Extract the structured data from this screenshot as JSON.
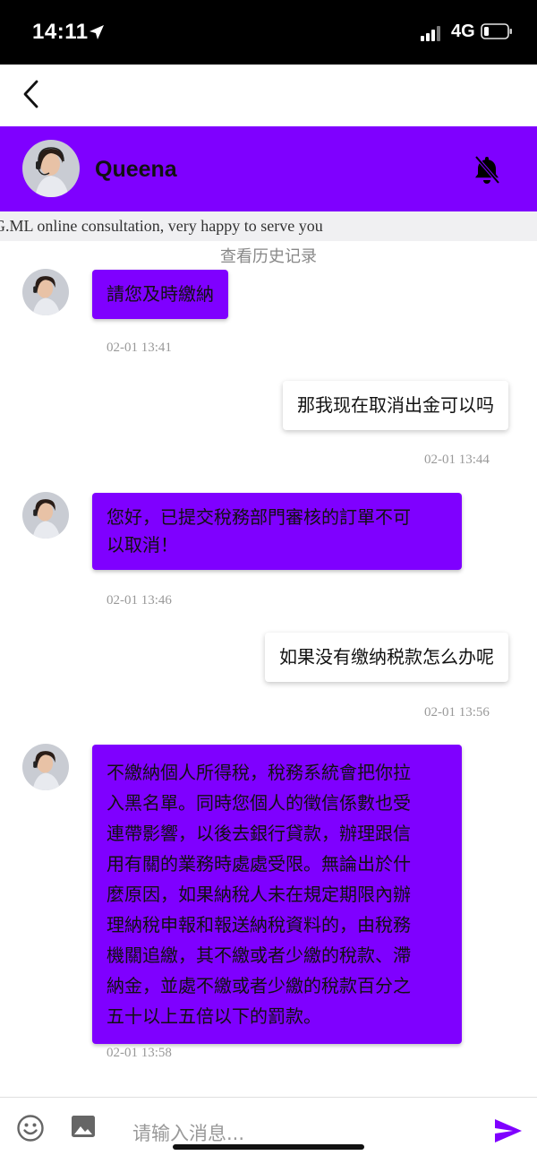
{
  "status_bar": {
    "time": "14:11",
    "network": "4G"
  },
  "header": {
    "name": "Queena",
    "welcome": "G.ML online consultation, very happy to serve you"
  },
  "history_link": "查看历史记录",
  "messages": [
    {
      "direction": "incoming",
      "text": "請您及時繳納",
      "time": "02-01 13:41"
    },
    {
      "direction": "outgoing",
      "text": "那我现在取消出金可以吗",
      "time": "02-01 13:44"
    },
    {
      "direction": "incoming",
      "lines": [
        "您好，已提交稅務部門審核的訂單不可",
        "以取消！"
      ],
      "time": "02-01 13:46"
    },
    {
      "direction": "outgoing",
      "text": "如果没有缴纳税款怎么办呢",
      "time": "02-01 13:56"
    },
    {
      "direction": "incoming",
      "lines": [
        "不繳納個人所得稅，稅務系統會把你拉",
        "入黑名單。同時您個人的徵信係數也受",
        "連帶影響，以後去銀行貸款，辦理跟信",
        "用有關的業務時處處受限。無論出於什",
        "麼原因，如果納稅人未在規定期限內辦",
        "理納稅申報和報送納稅資料的，由稅務",
        "機關追繳，其不繳或者少繳的稅款、滯",
        "納金，並處不繳或者少繳的稅款百分之",
        "五十以上五倍以下的罰款。"
      ],
      "time": "02-01 13:58"
    }
  ],
  "input": {
    "placeholder": "请输入消息..."
  },
  "colors": {
    "accent": "#7f00ff",
    "send_icon": "#7f00ff"
  },
  "icons": [
    "location-arrow-icon",
    "signal-icon",
    "battery-icon",
    "back-arrow-icon",
    "bell-off-icon",
    "emoji-icon",
    "image-icon",
    "send-icon"
  ]
}
